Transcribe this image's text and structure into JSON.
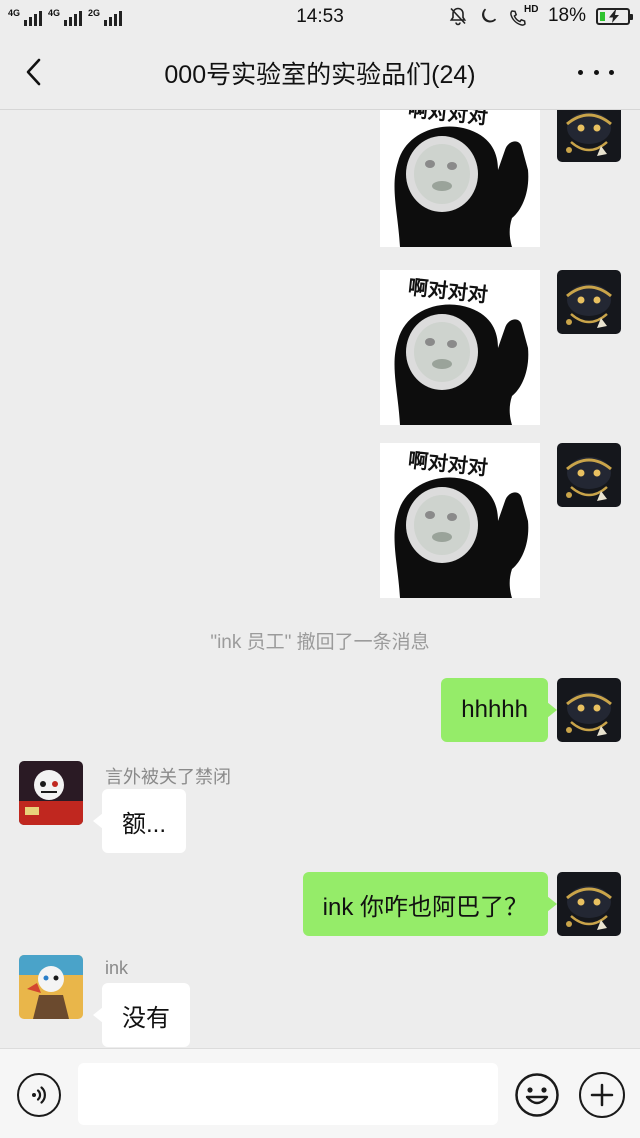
{
  "status_bar": {
    "signals": [
      {
        "net": "4G"
      },
      {
        "net": "4G"
      },
      {
        "net": "2G"
      }
    ],
    "time": "14:53",
    "hd_label": "HD",
    "battery_percent": "18%",
    "battery_level": 0.18,
    "icons": [
      "mute-bell-icon",
      "moon-icon",
      "hd-call-icon",
      "battery-charging-icon"
    ]
  },
  "header": {
    "back_icon": "chevron-left-icon",
    "title": "000号实验室的实验品们(24)",
    "more_icon": "more-dots-icon"
  },
  "stickers": {
    "caption": "啊对对对"
  },
  "messages": {
    "recall_notice": "\"ink 员工\" 撤回了一条消息",
    "me_1": "hhhhh",
    "sender_1": "言外被关了禁闭",
    "them_1": "额...",
    "me_2": "ink 你咋也阿巴了？",
    "sender_2": "ink",
    "them_2": "没有"
  },
  "input_bar": {
    "voice_icon": "voice-icon",
    "input_value": "",
    "emoji_icon": "emoji-icon",
    "plus_icon": "plus-icon"
  },
  "colors": {
    "background": "#ededed",
    "my_bubble": "#95ec69",
    "their_bubble": "#ffffff",
    "battery_fill": "#2ec22e"
  }
}
